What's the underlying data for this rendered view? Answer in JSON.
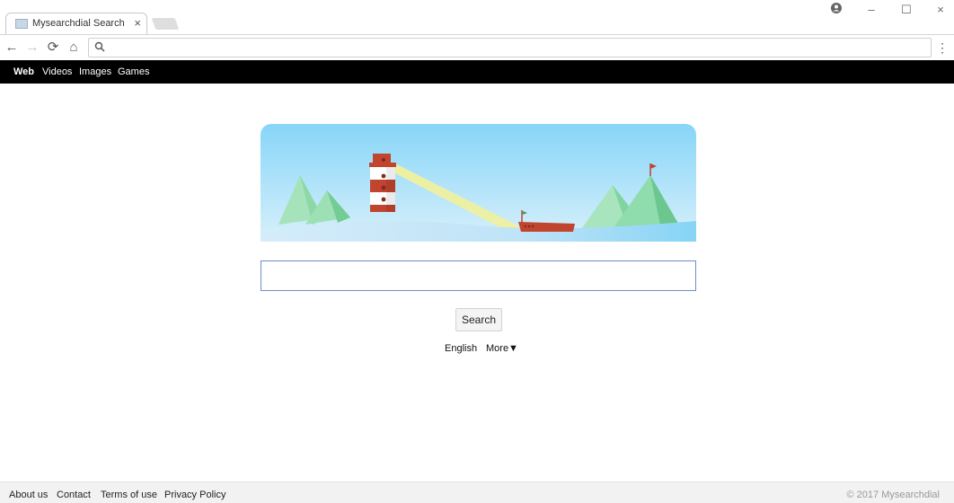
{
  "browser": {
    "tab_title": "Mysearchdial Search",
    "tab_close": "×",
    "window_controls": {
      "account": "account-icon",
      "minimize": "–",
      "maximize": "☐",
      "close": "×"
    },
    "nav": {
      "back": "←",
      "forward": "→",
      "reload": "⟳",
      "home": "⌂"
    },
    "address_value": "",
    "menu": "⋮"
  },
  "site_nav": {
    "items": [
      {
        "label": "Web",
        "active": true
      },
      {
        "label": "Videos",
        "active": false
      },
      {
        "label": "Images",
        "active": false
      },
      {
        "label": "Games",
        "active": false
      }
    ]
  },
  "search": {
    "query": "",
    "button_label": "Search",
    "language": "English",
    "more_label": "More▼"
  },
  "footer": {
    "links": [
      "About us",
      "Contact",
      "Terms of use",
      "Privacy Policy"
    ],
    "copyright": "© 2017 Mysearchdial"
  },
  "colors": {
    "nav_background": "#000000",
    "sky_top": "#87d5f8",
    "sky_bottom": "#d8f0fb",
    "mountain_green": "#7fd6a0",
    "lighthouse_red": "#c0442e",
    "light_beam": "#eef0a0"
  }
}
